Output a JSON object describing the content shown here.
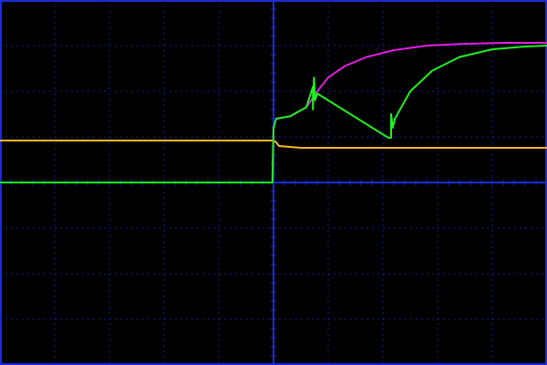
{
  "chart_data": {
    "type": "line",
    "title": "",
    "xlabel": "",
    "ylabel": "",
    "xlim": [
      -5,
      5
    ],
    "ylim": [
      -4,
      4
    ],
    "x_divisions": 10,
    "y_divisions": 8,
    "grid": true,
    "grid_color": "#1a2bd6",
    "background": "#000000",
    "series": [
      {
        "name": "yellow",
        "color": "#f5b731",
        "x": [
          -5,
          0,
          0.05,
          0.1,
          0.3,
          0.5,
          5
        ],
        "y": [
          0.92,
          0.92,
          0.88,
          0.8,
          0.78,
          0.76,
          0.76
        ]
      },
      {
        "name": "magenta",
        "color": "#e020e0",
        "x": [
          -5,
          -0.02,
          0.0,
          0.05,
          0.3,
          0.6,
          0.8,
          1.0,
          1.3,
          1.7,
          2.2,
          2.8,
          3.5,
          4.2,
          5
        ],
        "y": [
          0,
          0,
          1.2,
          1.4,
          1.45,
          1.65,
          2.0,
          2.3,
          2.55,
          2.75,
          2.9,
          3.0,
          3.04,
          3.06,
          3.06
        ]
      },
      {
        "name": "green",
        "color": "#22ee22",
        "x": [
          -5,
          -0.02,
          0.0,
          0.05,
          0.3,
          0.6,
          0.72,
          0.72,
          0.74,
          0.76,
          0.8,
          2.1,
          2.15,
          2.15,
          2.18,
          2.22,
          2.5,
          2.9,
          3.4,
          4.0,
          4.6,
          5
        ],
        "y": [
          0,
          0,
          1.2,
          1.4,
          1.45,
          1.65,
          2.1,
          1.6,
          2.3,
          1.8,
          1.95,
          0.98,
          0.98,
          1.5,
          1.2,
          1.4,
          2.0,
          2.45,
          2.75,
          2.92,
          2.98,
          3.0
        ]
      }
    ]
  }
}
